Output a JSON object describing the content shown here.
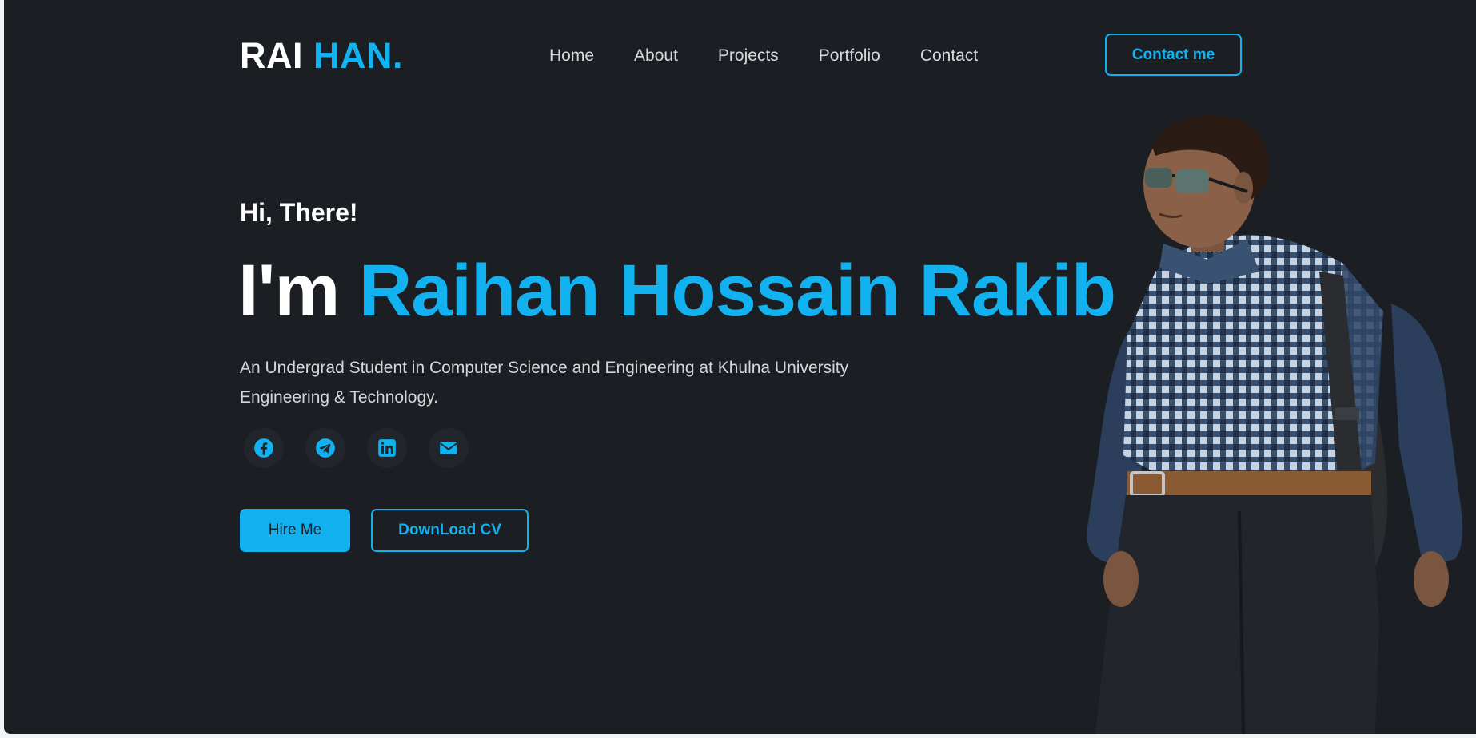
{
  "brand": {
    "logo_main": "RAI",
    "logo_accent": "HAN."
  },
  "nav": {
    "items": [
      "Home",
      "About",
      "Projects",
      "Portfolio",
      "Contact"
    ],
    "cta_label": "Contact me"
  },
  "hero": {
    "greeting": "Hi, There!",
    "intro": "I'm",
    "name": "Raihan Hossain Rakib",
    "description": "An Undergrad Student in Computer Science and Engineering at Khulna University Engineering & Technology.",
    "socials": [
      {
        "icon": "facebook-icon"
      },
      {
        "icon": "telegram-icon"
      },
      {
        "icon": "linkedin-icon"
      },
      {
        "icon": "email-icon"
      }
    ],
    "hire_label": "Hire Me",
    "cv_label": "DownLoad CV"
  },
  "colors": {
    "background": "#1b1e23",
    "accent": "#12b2f0",
    "text": "#ffffff"
  }
}
